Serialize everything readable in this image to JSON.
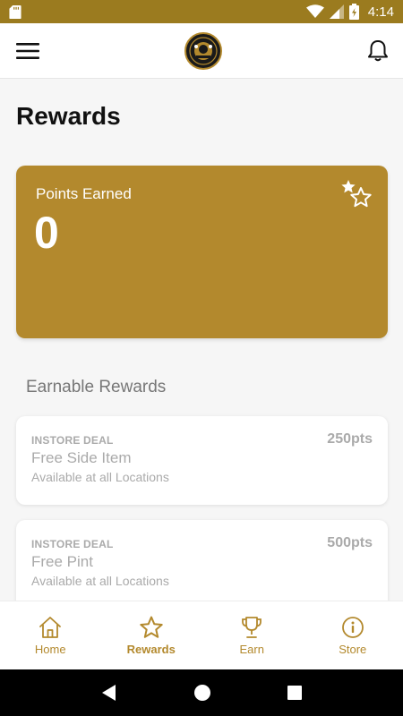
{
  "status_bar": {
    "time": "4:14",
    "icons": [
      "sd-card-icon",
      "wifi-icon",
      "signal-icon",
      "battery-icon"
    ]
  },
  "header": {
    "menu_icon": "hamburger-menu-icon",
    "logo_icon": "brand-logo",
    "notification_icon": "bell-icon"
  },
  "page": {
    "title": "Rewards"
  },
  "points_card": {
    "label": "Points Earned",
    "value": "0",
    "icon": "stars-icon"
  },
  "earnable": {
    "section_title": "Earnable Rewards",
    "rewards": [
      {
        "type": "INSTORE DEAL",
        "name": "Free Side Item",
        "availability": "Available at all Locations",
        "points": "250pts"
      },
      {
        "type": "INSTORE DEAL",
        "name": "Free Pint",
        "availability": "Available at all Locations",
        "points": "500pts"
      }
    ]
  },
  "bottom_nav": {
    "items": [
      {
        "label": "Home",
        "icon": "home-icon",
        "active": false
      },
      {
        "label": "Rewards",
        "icon": "star-icon",
        "active": true
      },
      {
        "label": "Earn",
        "icon": "trophy-icon",
        "active": false
      },
      {
        "label": "Store",
        "icon": "info-icon",
        "active": false
      }
    ]
  },
  "android_nav": {
    "icons": [
      "back-icon",
      "home-circle-icon",
      "recents-icon"
    ]
  },
  "colors": {
    "accent": "#b3892d",
    "status_bar": "#9b7b1f",
    "muted_text": "#aaaaaa"
  }
}
